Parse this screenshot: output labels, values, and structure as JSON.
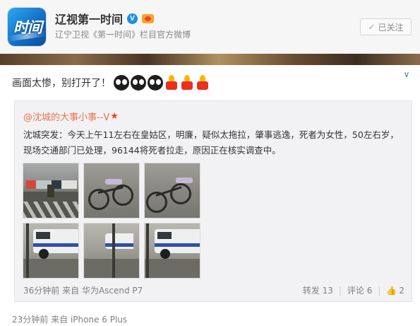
{
  "profile": {
    "name": "辽视第一时间",
    "bio": "辽宁卫视《第一时间》栏目官方微博",
    "logo_text": "时间",
    "verified_icon": "verified-v-icon",
    "follow_button": {
      "check": "✓",
      "label": "已关注"
    }
  },
  "post": {
    "text": "画面太惨，别打开了！",
    "emojis": [
      "eyes-emoji",
      "eyes-emoji",
      "eyes-emoji",
      "candle-emoji",
      "candle-emoji",
      "candle-emoji"
    ],
    "expand_icon": "∨",
    "quote": {
      "user": "@沈城的大事小事--V",
      "badge_icon": "★",
      "body": "沈城突发：今天上午11左右在皇姑区，明廉，疑似太拖拉，肇事逃逸，死者为女性，50左右岁，现场交通部门已处理，96144将死者拉走，原因正在核实调查中。",
      "photos": [
        "street",
        "bikes",
        "bikes",
        "van",
        "van-street",
        "van"
      ],
      "time": "36分钟前",
      "from_label": "来自",
      "device": "华为Ascend P7",
      "repost": "转发 13",
      "comment": "评论 6",
      "like_icon": "👍",
      "like_count": "2"
    },
    "time": "23分钟前",
    "from_label": "来自",
    "device": "iPhone 6 Plus"
  },
  "colors": {
    "accent": "#eb7350",
    "link": "#4a7fb5",
    "muted": "#808080",
    "verified": "#1d8fe6"
  }
}
